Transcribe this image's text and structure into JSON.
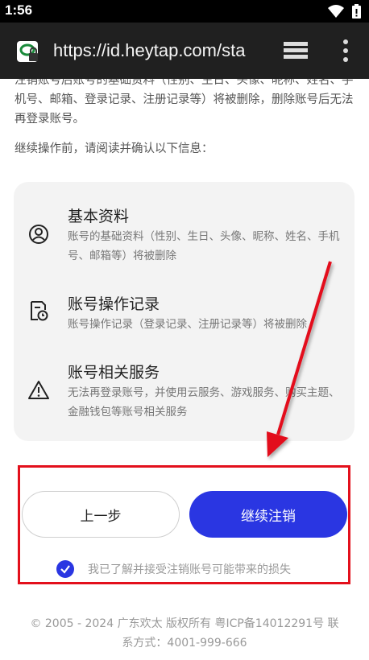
{
  "status_bar": {
    "time": "1:56"
  },
  "browser": {
    "url": "https://id.heytap.com/sta"
  },
  "intro_text": "注销账号后账号的基础资料（性别、生日、头像、昵称、姓名、手机号、邮箱、登录记录、注册记录等）将被删除，删除账号后无法再登录账号。",
  "confirm_prompt": "继续操作前，请阅读并确认以下信息：",
  "info_items": [
    {
      "icon": "user-circle-icon",
      "title": "基本资料",
      "desc": "账号的基础资料（性别、生日、头像、昵称、姓名、手机号、邮箱等）将被删除"
    },
    {
      "icon": "document-clock-icon",
      "title": "账号操作记录",
      "desc": "账号操作记录（登录记录、注册记录等）将被删除"
    },
    {
      "icon": "warning-triangle-icon",
      "title": "账号相关服务",
      "desc": "无法再登录账号，并使用云服务、游戏服务、购买主题、金融钱包等账号相关服务"
    }
  ],
  "buttons": {
    "prev": "上一步",
    "next": "继续注销"
  },
  "agreement": {
    "label": "我已了解并接受注销账号可能带来的损失",
    "checked": true
  },
  "footer": {
    "line1": "© 2005 - 2024 广东欢太 版权所有 粤ICP备14012291号 联",
    "line2": "系方式：4001-999-666"
  },
  "colors": {
    "accent": "#2a36e2",
    "annotation": "#e3101c"
  }
}
